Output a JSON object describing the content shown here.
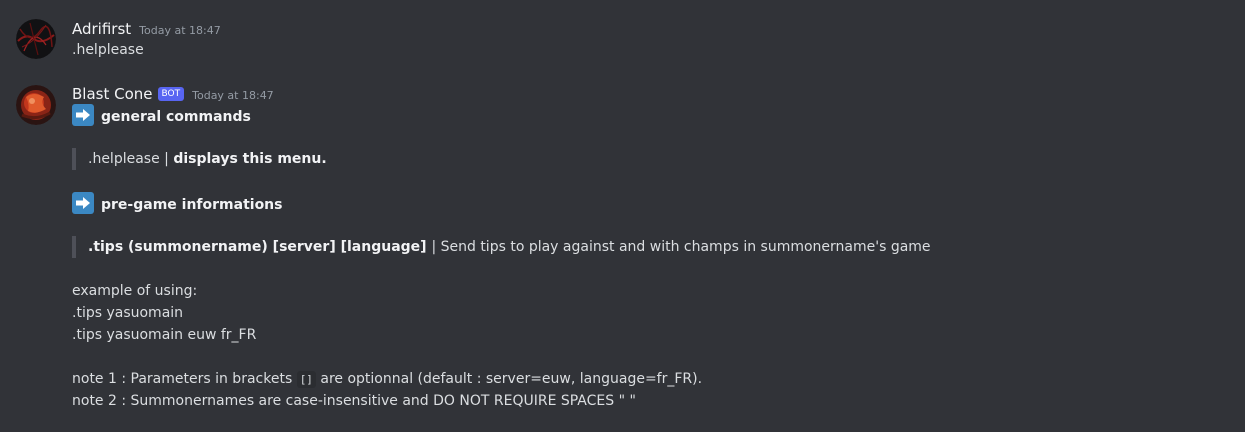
{
  "messages": [
    {
      "username": "Adrifirst",
      "timestamp": "Today at 18:47",
      "content": ".helplease"
    },
    {
      "username": "Blast Cone",
      "bot_tag": "BOT",
      "timestamp": "Today at 18:47",
      "section1_title": "general commands",
      "quote1_plain": ".helplease | ",
      "quote1_bold": "displays this menu.",
      "section2_title": "pre-game informations",
      "quote2_bold": ".tips (summonername) [server] [language] ",
      "quote2_plain": " | Send tips to play against and with champs in summonername's game",
      "example_heading": "example of using:",
      "example1": ".tips yasuomain",
      "example2": ".tips yasuomain euw fr_FR",
      "note1_pre": "note 1 : Parameters in brackets ",
      "note1_code": "[]",
      "note1_post": " are optionnal (default : server=euw, language=fr_FR).",
      "note2": "note 2 : Summonernames are case-insensitive and DO NOT REQUIRE SPACES \" \""
    }
  ],
  "icons": {
    "arrow_emoji": "arrow-right-icon"
  },
  "colors": {
    "background": "#313338",
    "bot_tag": "#5865f2",
    "emoji_blue": "#3b88c3"
  }
}
